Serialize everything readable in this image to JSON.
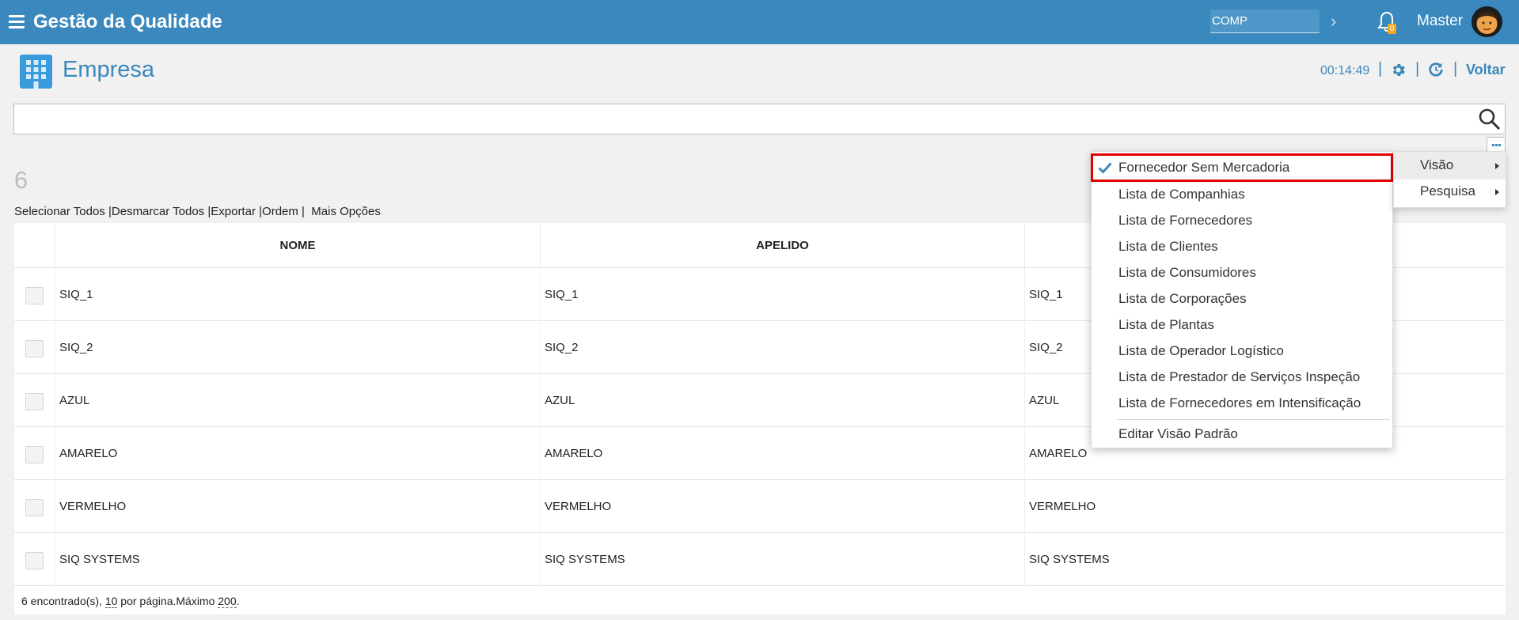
{
  "header": {
    "app_title": "Gestão da Qualidade",
    "company": "COMP",
    "notifications": "0",
    "user": "Master",
    "menu_icon": "hamburger-icon",
    "bell_icon": "bell-icon",
    "color": "#3a88bd"
  },
  "page": {
    "title": "Empresa",
    "icon": "building-grid-icon",
    "timer": "00:14:49",
    "back_label": "Voltar",
    "separator": "|"
  },
  "search": {
    "value": "",
    "placeholder": "",
    "icon": "search-icon"
  },
  "results": {
    "count": "6",
    "actions": [
      "Selecionar Todos",
      "Desmarcar Todos",
      "Exportar",
      "Ordem",
      "Mais Opções"
    ]
  },
  "table": {
    "columns": [
      "NOME",
      "APELIDO",
      ""
    ],
    "rows": [
      [
        "SIQ_1",
        "SIQ_1",
        "SIQ_1"
      ],
      [
        "SIQ_2",
        "SIQ_2",
        "SIQ_2"
      ],
      [
        "AZUL",
        "AZUL",
        "AZUL"
      ],
      [
        "AMARELO",
        "AMARELO",
        "AMARELO"
      ],
      [
        "VERMELHO",
        "VERMELHO",
        "VERMELHO"
      ],
      [
        "SIQ SYSTEMS",
        "SIQ SYSTEMS",
        "SIQ SYSTEMS"
      ]
    ],
    "footer": {
      "found": "6 encontrado(s), ",
      "per_page": "10",
      "per_page_suffix": " por página.Máximo ",
      "max": "200",
      "end": "."
    }
  },
  "view_menu": {
    "items": [
      "Fornecedor Sem Mercadoria",
      "Lista de Companhias",
      "Lista de Fornecedores",
      "Lista de Clientes",
      "Lista de Consumidores",
      "Lista de Corporações",
      "Lista de Plantas",
      "Lista de Operador Logístico",
      "Lista de Prestador de Serviços Inspeção",
      "Lista de Fornecedores em Intensificação"
    ],
    "selected_index": 0,
    "edit_default": "Editar Visão Padrão",
    "check_icon": "checkmark-icon",
    "highlight_color": "#e00000"
  },
  "submenu": {
    "items": [
      "Visão",
      "Pesquisa"
    ]
  }
}
